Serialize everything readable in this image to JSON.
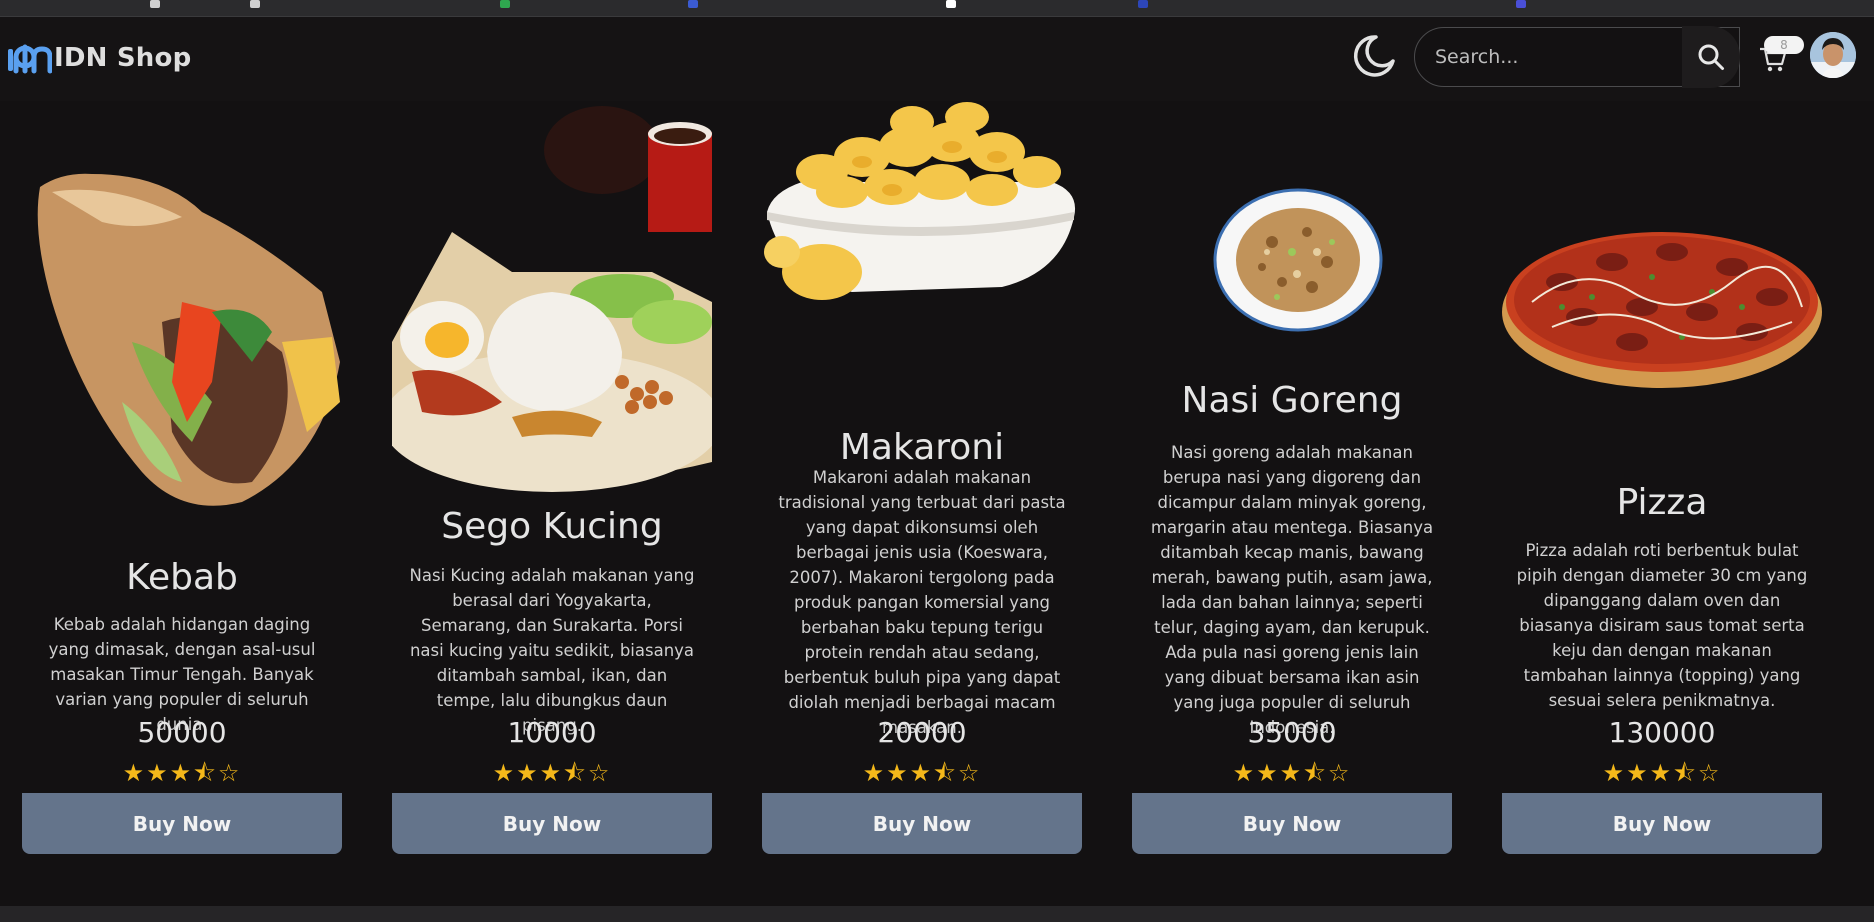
{
  "brand": {
    "name": "IDN Shop"
  },
  "search": {
    "placeholder": "Search..."
  },
  "cart": {
    "count": "8"
  },
  "colors": {
    "button": "#64748b",
    "star": "#f4b81a",
    "background": "#131112",
    "brand_logo": "#5aa0f0"
  },
  "icons": {
    "theme": "moon-icon",
    "search": "search-icon",
    "cart": "cart-icon"
  },
  "products": [
    {
      "name": "Kebab",
      "description": "Kebab adalah hidangan daging yang dimasak, dengan asal-usul masakan Timur Tengah. Banyak varian yang populer di seluruh dunia.",
      "price": "50000",
      "rating": "★★★⯪☆",
      "rating_value": 3.5,
      "button": "Buy Now"
    },
    {
      "name": "Sego Kucing",
      "description": "Nasi Kucing adalah makanan yang berasal dari Yogyakarta, Semarang, dan Surakarta. Porsi nasi kucing yaitu sedikit, biasanya ditambah sambal, ikan, dan tempe, lalu dibungkus daun pisang.",
      "price": "10000",
      "rating": "★★★⯪☆",
      "rating_value": 3.5,
      "button": "Buy Now"
    },
    {
      "name": "Makaroni",
      "description": "Makaroni adalah makanan tradisional yang terbuat dari pasta yang dapat dikonsumsi oleh berbagai jenis usia (Koeswara, 2007). Makaroni tergolong pada produk pangan komersial yang berbahan baku tepung terigu protein rendah atau sedang, berbentuk buluh pipa yang dapat diolah menjadi berbagai macam masakan.",
      "price": "20000",
      "rating": "★★★⯪☆",
      "rating_value": 3.5,
      "button": "Buy Now"
    },
    {
      "name": "Nasi Goreng",
      "description": "Nasi goreng adalah makanan berupa nasi yang digoreng dan dicampur dalam minyak goreng, margarin atau mentega. Biasanya ditambah kecap manis, bawang merah, bawang putih, asam jawa, lada dan bahan lainnya; seperti telur, daging ayam, dan kerupuk. Ada pula nasi goreng jenis lain yang dibuat bersama ikan asin yang juga populer di seluruh Indonesia.",
      "price": "35000",
      "rating": "★★★⯪☆",
      "rating_value": 3.5,
      "button": "Buy Now"
    },
    {
      "name": "Pizza",
      "description": "Pizza adalah roti berbentuk bulat pipih dengan diameter 30 cm yang dipanggang dalam oven dan biasanya disiram saus tomat serta keju dan dengan makanan tambahan lainnya (topping) yang sesuai selera penikmatnya.",
      "price": "130000",
      "rating": "★★★⯪☆",
      "rating_value": 3.5,
      "button": "Buy Now"
    }
  ]
}
